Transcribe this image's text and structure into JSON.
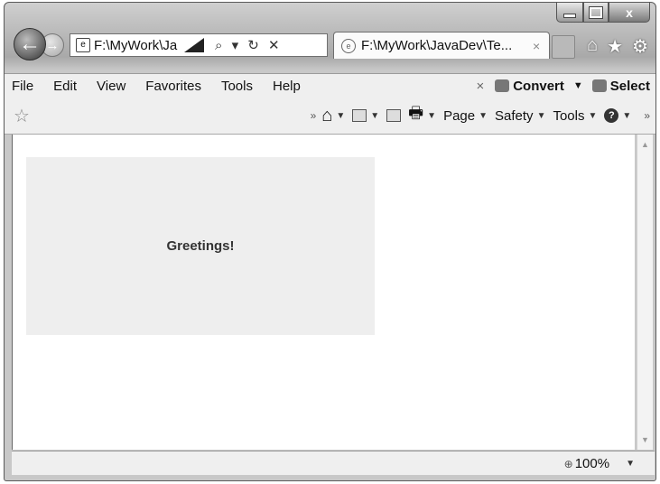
{
  "window": {
    "caption": {
      "close_glyph": "x"
    }
  },
  "navigation": {
    "address_text": "F:\\MyWork\\Ja",
    "address_controls": "⌕ ▾ ↻ ✕",
    "tab_title": "F:\\MyWork\\JavaDev\\Te...",
    "tab_close": "×"
  },
  "menu": {
    "items": [
      "File",
      "Edit",
      "View",
      "Favorites",
      "Tools",
      "Help"
    ],
    "close_x": "×",
    "convert_label": "Convert",
    "select_label": "Select"
  },
  "commandbar": {
    "overflow": "»",
    "page_label": "Page",
    "safety_label": "Safety",
    "tools_label": "Tools"
  },
  "content": {
    "greeting": "Greetings!"
  },
  "status": {
    "zoom": "100%"
  }
}
